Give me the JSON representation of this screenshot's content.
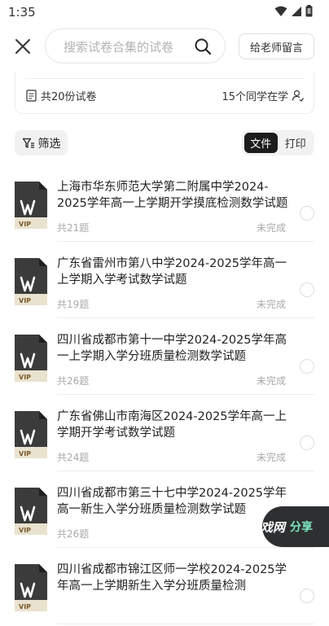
{
  "status_bar": {
    "time": "1:35",
    "icons": [
      "wifi-icon",
      "signal-icon",
      "battery-icon"
    ]
  },
  "header": {
    "search_placeholder": "搜索试卷合集的试卷",
    "message_button": "给老师留言"
  },
  "summary": {
    "paper_count_text": "共20份试卷",
    "learners_text": "15个同学在学"
  },
  "filter": {
    "label": "筛选",
    "view_options": [
      "文件",
      "打印"
    ],
    "active_view": "文件"
  },
  "papers": [
    {
      "title": "上海市华东师范大学第二附属中学2024-2025学年高一上学期开学摸底检测数学试题",
      "count": "共21题",
      "status": "未完成",
      "badge": "VIP"
    },
    {
      "title": "广东省雷州市第八中学2024-2025学年高一上学期入学考试数学试题",
      "count": "共19题",
      "status": "未完成",
      "badge": "VIP"
    },
    {
      "title": "四川省成都市第十一中学2024-2025学年高一上学期入学分班质量检测数学试题",
      "count": "共26题",
      "status": "未完成",
      "badge": "VIP"
    },
    {
      "title": "广东省佛山市南海区2024-2025学年高一上学期开学考试数学试题",
      "count": "共24题",
      "status": "未完成",
      "badge": "VIP"
    },
    {
      "title": "四川省成都市第三十七中学2024-2025学年高一新生入学分班质量检测数学试题",
      "count": "共26题",
      "status": "",
      "badge": "VIP"
    },
    {
      "title": "四川省成都市锦江区师一学校2024-2025学年高一上学期新生入学分班质量检测",
      "count": "",
      "status": "",
      "badge": "VIP"
    }
  ],
  "share": {
    "watermark": "戏网",
    "label": "分享"
  },
  "colors": {
    "accent_dark": "#1c1c1c",
    "share_bg": "#2d2f31",
    "share_text": "#7fe7c0",
    "muted_text": "#aaaaaa"
  }
}
